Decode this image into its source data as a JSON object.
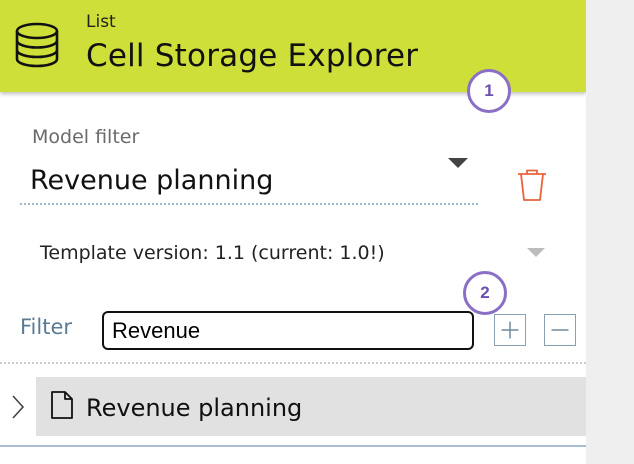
{
  "header": {
    "subtitle": "List",
    "title": "Cell Storage Explorer",
    "color": "#cfdf3a",
    "icon": "database-icon"
  },
  "badges": [
    "1",
    "2"
  ],
  "model_filter": {
    "label": "Model filter",
    "value": "Revenue planning",
    "delete_icon": "trash-icon"
  },
  "template": {
    "text": "Template version: 1.1 (current: 1.0!)"
  },
  "filter": {
    "label": "Filter",
    "value": "Revenue",
    "add_icon": "plus-square-icon",
    "remove_icon": "minus-square-icon"
  },
  "tree": {
    "items": [
      {
        "label": "Revenue planning",
        "icon": "document-icon",
        "expanded": false
      }
    ]
  }
}
